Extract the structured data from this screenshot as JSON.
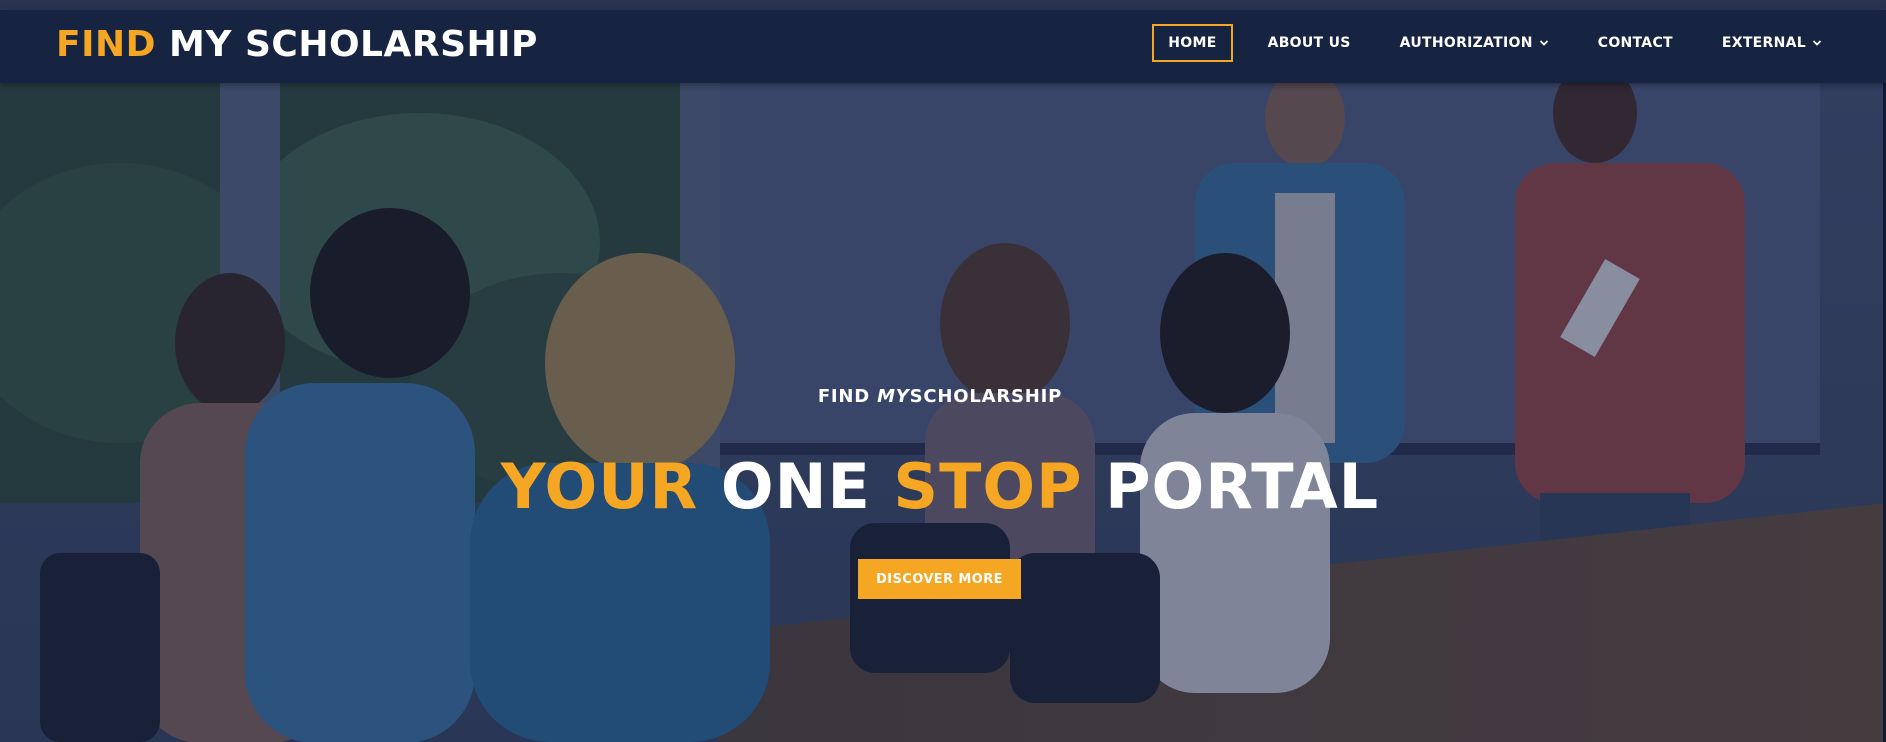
{
  "brand": {
    "logo_part1": "FIND",
    "logo_part2": "MY SCHOLARSHIP",
    "accent_color": "#f5a623",
    "nav_background": "#172441"
  },
  "nav": {
    "items": [
      {
        "label": "HOME",
        "active": true,
        "dropdown": false
      },
      {
        "label": "ABOUT US",
        "active": false,
        "dropdown": false
      },
      {
        "label": "AUTHORIZATION",
        "active": false,
        "dropdown": true,
        "icon": "chevron-down-icon"
      },
      {
        "label": "CONTACT",
        "active": false,
        "dropdown": false
      },
      {
        "label": "EXTERNAL",
        "active": false,
        "dropdown": true,
        "icon": "chevron-down-icon"
      }
    ]
  },
  "hero": {
    "background_image": "classroom-photo",
    "subtitle_part1": "FIND",
    "subtitle_part2": "MY",
    "subtitle_part3": "SCHOLARSHIP",
    "title_word1": "YOUR",
    "title_word2": "ONE",
    "title_word3": "STOP",
    "title_word4": "PORTAL",
    "cta_label": "DISCOVER MORE"
  }
}
